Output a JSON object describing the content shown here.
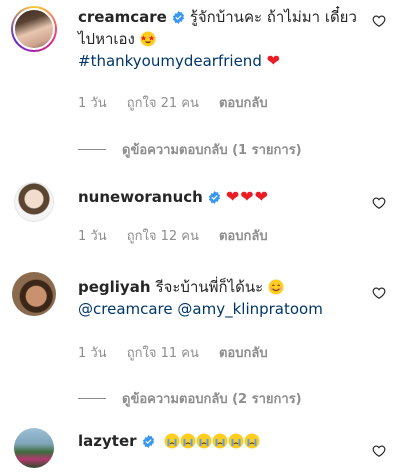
{
  "comments": [
    {
      "username": "creamcare",
      "verified": true,
      "text": "รู้จักบ้านคะ ถ้าไม่มา เดี๋ยวไปหาเอง",
      "hashtag": "#thankyoumydearfriend",
      "time": "1 วัน",
      "likes": "ถูกใจ 21 คน",
      "reply": "ตอบกลับ",
      "view_replies": "ดูข้อความตอบกลับ (1 รายการ)"
    },
    {
      "username": "nuneworanuch",
      "verified": true,
      "text": "",
      "time": "1 วัน",
      "likes": "ถูกใจ 12 คน",
      "reply": "ตอบกลับ"
    },
    {
      "username": "pegliyah",
      "verified": false,
      "text": "รีจะบ้านพี่ก็ได้นะ",
      "mention1": "@creamcare",
      "mention2": "@amy_klinpratoom",
      "time": "1 วัน",
      "likes": "ถูกใจ 11 คน",
      "reply": "ตอบกลับ",
      "view_replies": "ดูข้อความตอบกลับ (2 รายการ)"
    },
    {
      "username": "lazyter",
      "verified": true,
      "text": ""
    }
  ],
  "colors": {
    "verified": "#3897f0",
    "link": "#00376b",
    "muted": "#8e8e8e",
    "heart": "#ed1c24"
  }
}
